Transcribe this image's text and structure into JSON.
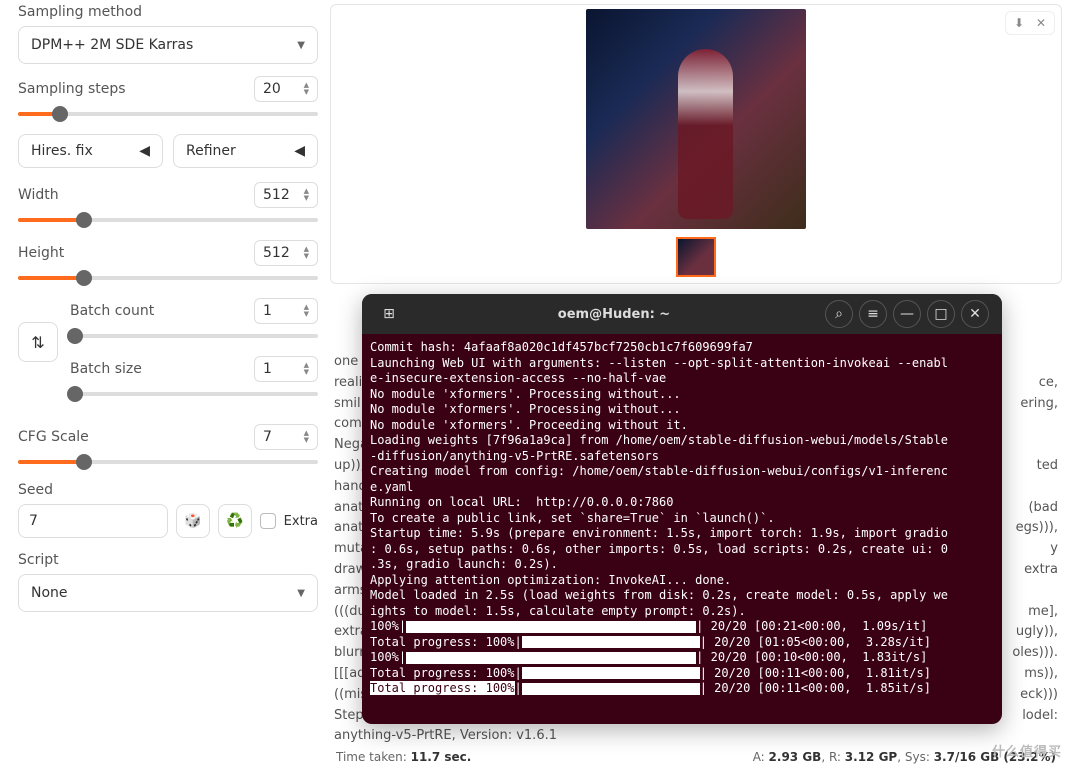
{
  "settings": {
    "sampling_method": {
      "label": "Sampling method",
      "value": "DPM++ 2M SDE Karras"
    },
    "sampling_steps": {
      "label": "Sampling steps",
      "value": "20",
      "pct": 14
    },
    "hires_fix": {
      "label": "Hires. fix"
    },
    "refiner": {
      "label": "Refiner"
    },
    "width": {
      "label": "Width",
      "value": "512",
      "pct": 22
    },
    "height": {
      "label": "Height",
      "value": "512",
      "pct": 22
    },
    "batch_count": {
      "label": "Batch count",
      "value": "1",
      "pct": 2
    },
    "batch_size": {
      "label": "Batch size",
      "value": "1",
      "pct": 2
    },
    "cfg_scale": {
      "label": "CFG Scale",
      "value": "7",
      "pct": 22
    },
    "seed": {
      "label": "Seed",
      "value": "7",
      "extra_label": "Extra"
    },
    "script": {
      "label": "Script",
      "value": "None"
    },
    "dice_icon": "🎲",
    "recycle_icon": "♻️"
  },
  "prompt_text": {
    "l1_left": "one",
    "l2_left": "reali",
    "l2_right": "ce,",
    "l3_left": "smil",
    "l3_right": "ering,",
    "l4_left": "com",
    "l5_left": "Nega",
    "l6_left": "up)),",
    "l6_right": "ted",
    "l7_left": "hand",
    "l8_left": "anat",
    "l8_right": "(bad",
    "l9_left": "anat",
    "l9_right": "egs))),",
    "l10_left": "muta",
    "l10_right": "y",
    "l11_left": "draw",
    "l11_right": "extra",
    "l12_left": "arms",
    "l13_left": "(((du",
    "l13_right": "me],",
    "l14_left": "extra",
    "l14_right": "ugly)),",
    "l15_left": "blurr",
    "l15_right": "oles))).",
    "l16_left": "[[[ad",
    "l16_right": "ms)),",
    "l17_left": "((mis",
    "l17_right": "eck)))",
    "l18_left": "Step",
    "l18_right": "lodel:",
    "l19_left": "anything-v5-PrtRE, Version: v1.6.1"
  },
  "footer": {
    "time_label": "Time taken: ",
    "time_value": "11.7 sec.",
    "mem": {
      "a": "2.93 GB",
      "r": "3.12 GP",
      "sys": "3.7/16 GB (23.2%)"
    }
  },
  "terminal": {
    "title": "oem@Huden: ~",
    "lines": [
      "Commit hash: 4afaaf8a020c1df457bcf7250cb1c7f609699fa7",
      "Launching Web UI with arguments: --listen --opt-split-attention-invokeai --enabl",
      "e-insecure-extension-access --no-half-vae",
      "No module 'xformers'. Processing without...",
      "No module 'xformers'. Processing without...",
      "No module 'xformers'. Proceeding without it.",
      "Loading weights [7f96a1a9ca] from /home/oem/stable-diffusion-webui/models/Stable",
      "-diffusion/anything-v5-PrtRE.safetensors",
      "Creating model from config: /home/oem/stable-diffusion-webui/configs/v1-inferenc",
      "e.yaml",
      "Running on local URL:  http://0.0.0.0:7860",
      "",
      "To create a public link, set `share=True` in `launch()`.",
      "Startup time: 5.9s (prepare environment: 1.5s, import torch: 1.9s, import gradio",
      ": 0.6s, setup paths: 0.6s, other imports: 0.5s, load scripts: 0.2s, create ui: 0",
      ".3s, gradio launch: 0.2s).",
      "Applying attention optimization: InvokeAI... done.",
      "Model loaded in 2.5s (load weights from disk: 0.2s, create model: 0.5s, apply we",
      "ights to model: 1.5s, calculate empty prompt: 0.2s)."
    ],
    "progress": [
      {
        "label": "100%",
        "stats": " 20/20 [00:21<00:00,  1.09s/it]"
      },
      {
        "label": "Total progress: 100%",
        "stats": " 20/20 [01:05<00:00,  3.28s/it]"
      },
      {
        "label": "100%",
        "stats": " 20/20 [00:10<00:00,  1.83it/s]"
      },
      {
        "label": "Total progress: 100%",
        "stats": " 20/20 [00:11<00:00,  1.81it/s]"
      },
      {
        "label": "Total progress: 100%",
        "stats": " 20/20 [00:11<00:00,  1.85it/s]"
      }
    ]
  },
  "watermark": "什么值得买"
}
